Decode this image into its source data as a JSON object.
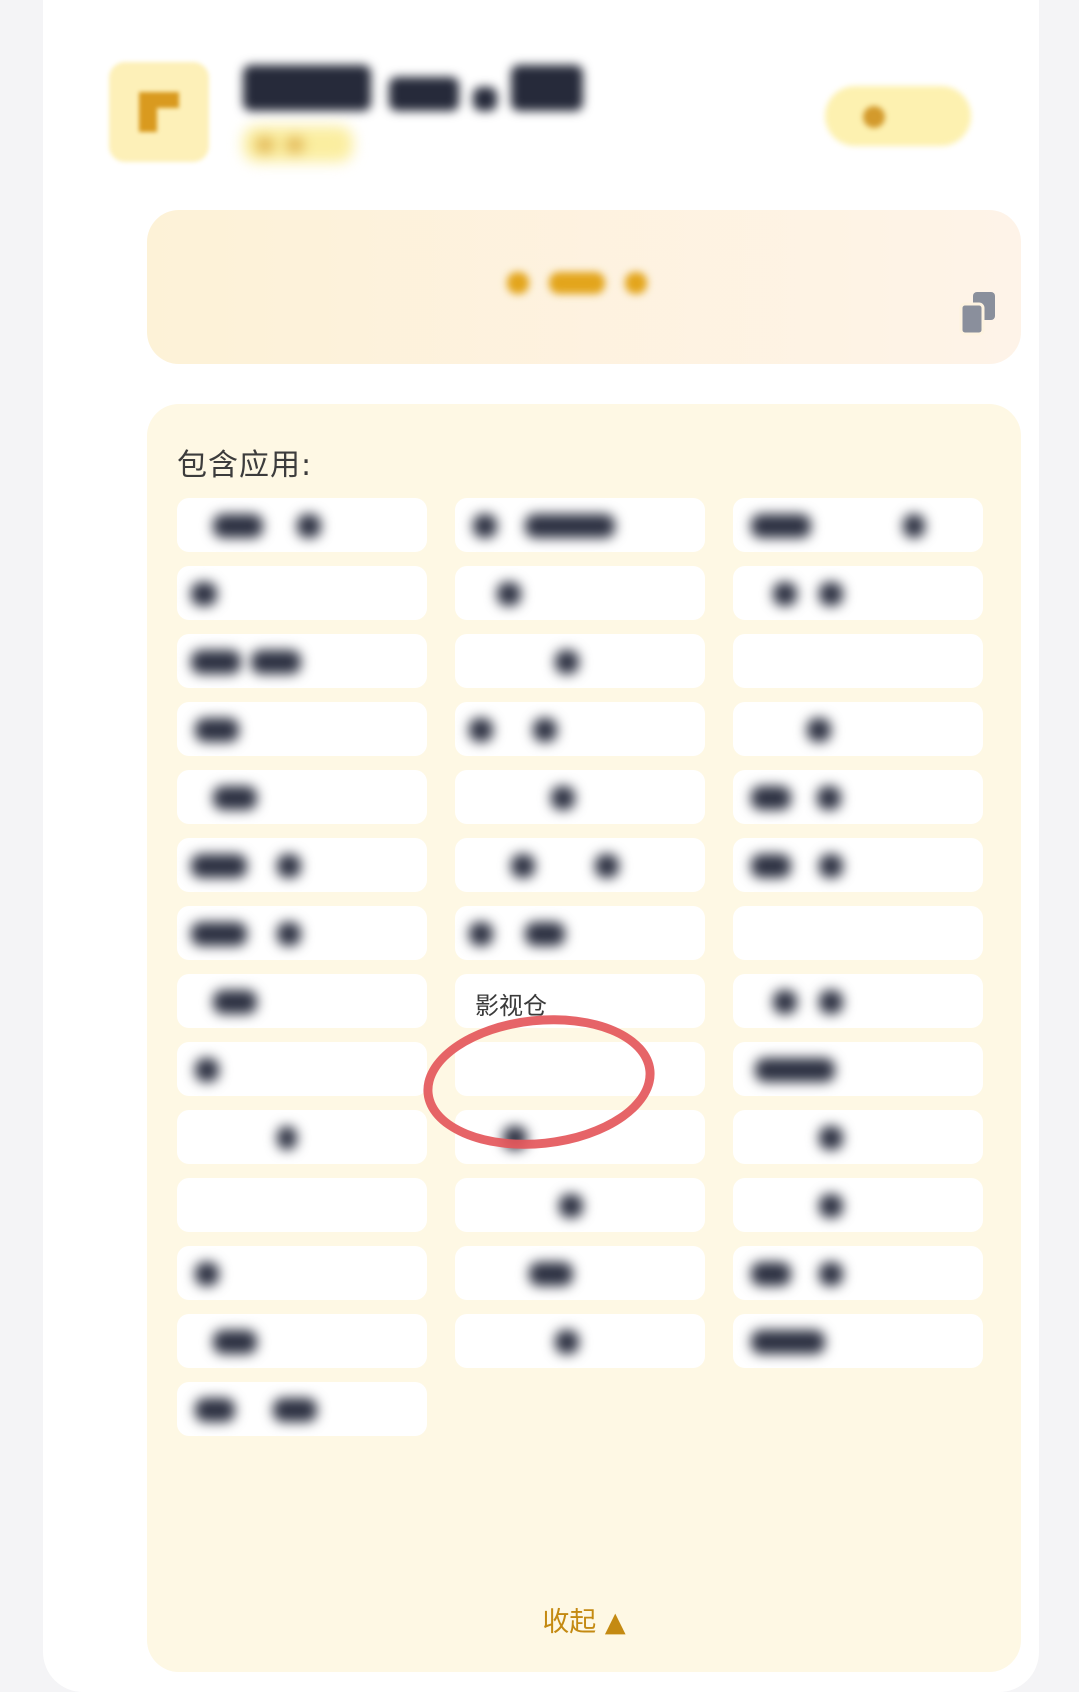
{
  "apps_section": {
    "title": "包含应用:",
    "apps": [
      {
        "label": ""
      },
      {
        "label": ""
      },
      {
        "label": ""
      },
      {
        "label": ""
      },
      {
        "label": ""
      },
      {
        "label": ""
      },
      {
        "label": ""
      },
      {
        "label": ""
      },
      {
        "label": ""
      },
      {
        "label": ""
      },
      {
        "label": ""
      },
      {
        "label": ""
      },
      {
        "label": ""
      },
      {
        "label": ""
      },
      {
        "label": ""
      },
      {
        "label": ""
      },
      {
        "label": ""
      },
      {
        "label": ""
      },
      {
        "label": ""
      },
      {
        "label": ""
      },
      {
        "label": ""
      },
      {
        "label": ""
      },
      {
        "label": "影视仓"
      },
      {
        "label": ""
      },
      {
        "label": ""
      },
      {
        "label": ""
      },
      {
        "label": ""
      },
      {
        "label": ""
      },
      {
        "label": ""
      },
      {
        "label": ""
      },
      {
        "label": ""
      },
      {
        "label": ""
      },
      {
        "label": ""
      },
      {
        "label": ""
      },
      {
        "label": ""
      },
      {
        "label": ""
      },
      {
        "label": ""
      },
      {
        "label": ""
      },
      {
        "label": ""
      },
      {
        "label": ""
      }
    ],
    "collapse_label": "收起 ▲"
  },
  "colors": {
    "accent": "#c48a12",
    "panel_bg": "#fef8e4",
    "highlight_circle": "#e4575b"
  }
}
